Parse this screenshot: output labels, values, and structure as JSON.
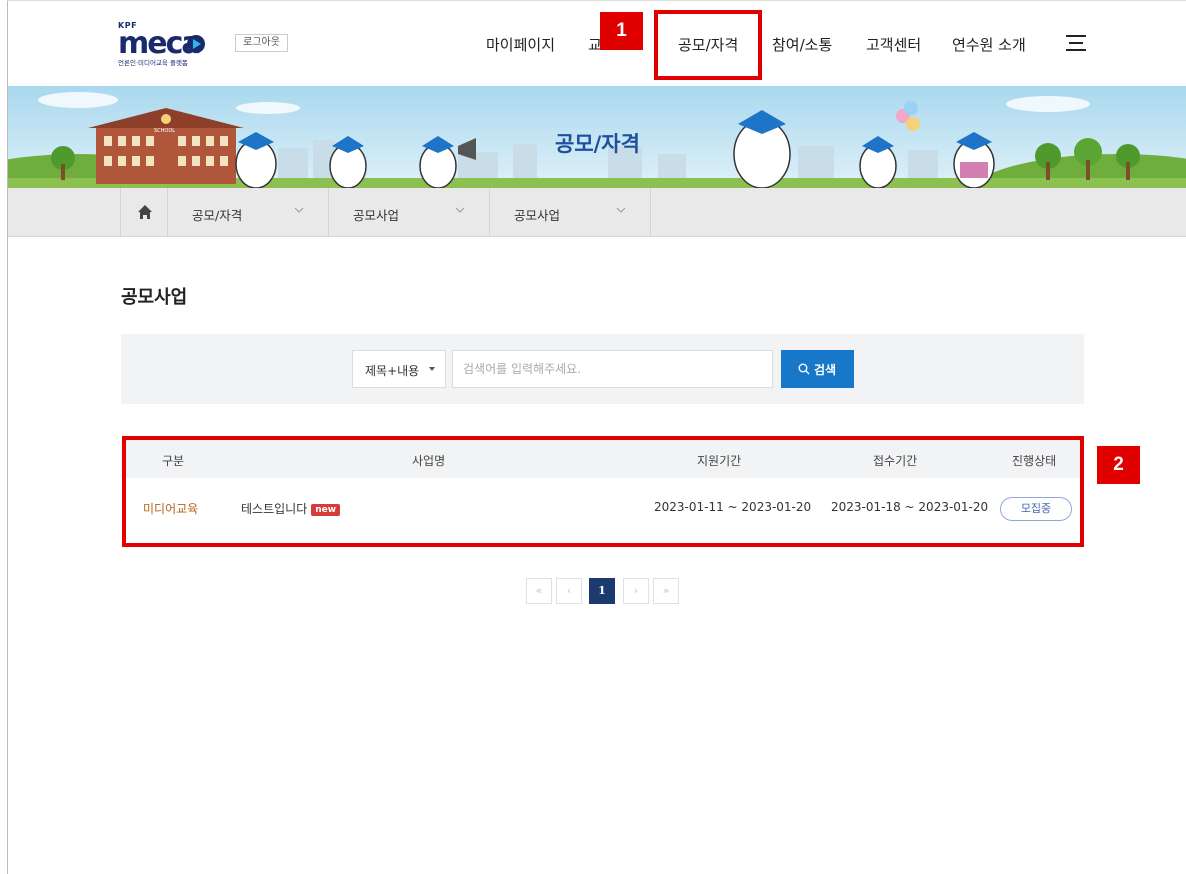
{
  "header": {
    "logo_brand": "KPF",
    "logo_word": "meca",
    "logo_subtitle": "언론인·미디어교육 플랫폼",
    "logout_label": "로그아웃",
    "nav": [
      {
        "label": "마이페이지"
      },
      {
        "label": "교"
      },
      {
        "label": "공모/자격"
      },
      {
        "label": "참여/소통"
      },
      {
        "label": "고객센터"
      },
      {
        "label": "연수원 소개"
      }
    ]
  },
  "annotations": [
    {
      "number": "1"
    },
    {
      "number": "2"
    }
  ],
  "banner": {
    "title": "공모/자격",
    "school_sign": "SCHOOL"
  },
  "breadcrumb": {
    "items": [
      {
        "label": "공모/자격"
      },
      {
        "label": "공모사업"
      },
      {
        "label": "공모사업"
      }
    ]
  },
  "page_title": "공모사업",
  "search": {
    "select_value": "제목+내용",
    "placeholder": "검색어를 입력해주세요.",
    "input_value": "",
    "button_label": "검색"
  },
  "table": {
    "headers": [
      "구분",
      "사업명",
      "지원기간",
      "접수기간",
      "진행상태"
    ],
    "rows": [
      {
        "category": "미디어교육",
        "title": "테스트입니다",
        "badge": "new",
        "support_period": "2023-01-11 ~ 2023-01-20",
        "receipt_period": "2023-01-18 ~ 2023-01-20",
        "status": "모집중"
      }
    ]
  },
  "pagination": {
    "first": "«",
    "prev": "‹",
    "current": "1",
    "next": "›",
    "last": "»"
  },
  "colors": {
    "accent_blue": "#1778c9",
    "annotation_red": "#e10000",
    "category_brown": "#b5651d",
    "pager_active": "#1b3a6d",
    "new_badge_red": "#d63c3c"
  }
}
